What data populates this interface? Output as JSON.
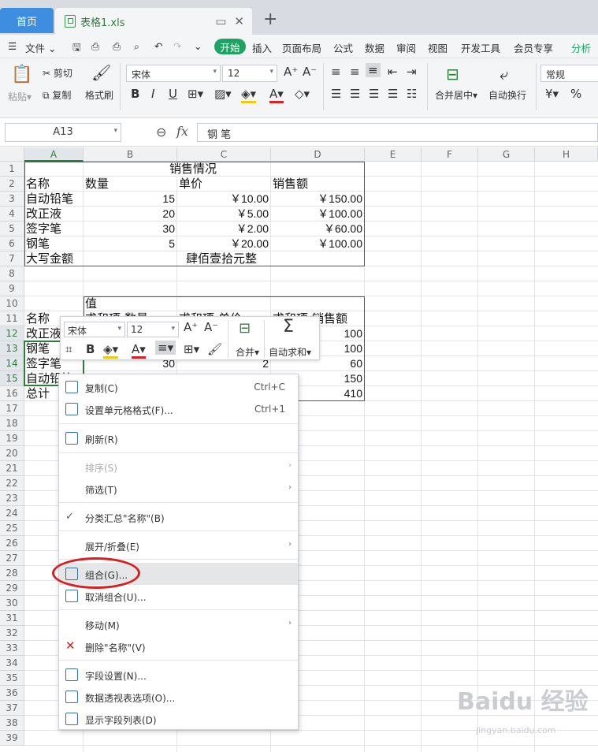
{
  "tabs": {
    "home": "首页",
    "file": "表格1.xls",
    "new_tab": "+"
  },
  "menu": {
    "file": "文件",
    "items": [
      "开始",
      "插入",
      "页面布局",
      "公式",
      "数据",
      "审阅",
      "视图",
      "开发工具",
      "会员专享",
      "分析"
    ]
  },
  "ribbon": {
    "paste": "粘贴",
    "cut": "剪切",
    "copy": "复制",
    "format_painter": "格式刷",
    "font": "宋体",
    "size": "12",
    "merge": "合并居中",
    "wrap": "自动换行",
    "number_format": "常规",
    "bold": "B",
    "italic": "I",
    "underline": "U",
    "currency": "¥",
    "percent": "%"
  },
  "formula_bar": {
    "cell_ref": "A13",
    "fx": "fx",
    "content": "钢 笔"
  },
  "columns": [
    "A",
    "B",
    "C",
    "D",
    "E",
    "F",
    "G",
    "H"
  ],
  "rows": [
    "1",
    "2",
    "3",
    "4",
    "5",
    "6",
    "7",
    "8",
    "9",
    "10",
    "11",
    "12",
    "13",
    "14",
    "15",
    "16",
    "17",
    "18",
    "19",
    "20",
    "21",
    "22",
    "23",
    "24",
    "25",
    "26",
    "27",
    "28",
    "29",
    "30",
    "31",
    "32",
    "33",
    "34",
    "35",
    "36",
    "37",
    "38",
    "39"
  ],
  "sheet": {
    "title": "销售情况",
    "header": [
      "名称",
      "数量",
      "单价",
      "销售额"
    ],
    "data": [
      {
        "name": "自动铅笔",
        "qty": "15",
        "price": "￥10.00",
        "amount": "￥150.00"
      },
      {
        "name": "改正液",
        "qty": "20",
        "price": "￥5.00",
        "amount": "￥100.00"
      },
      {
        "name": "签字笔",
        "qty": "30",
        "price": "￥2.00",
        "amount": "￥60.00"
      },
      {
        "name": "钢笔",
        "qty": "5",
        "price": "￥20.00",
        "amount": "￥100.00"
      }
    ],
    "total_label": "大写金额",
    "total_value": "肆佰壹拾元整",
    "pivot": {
      "values_label": "值",
      "header": [
        "名称",
        "求和项:数量",
        "求和项:单价",
        "求和项:销售额"
      ],
      "rows": [
        {
          "name": "改正液",
          "d": "100"
        },
        {
          "name": "钢笔",
          "d": "100"
        },
        {
          "name": "签字笔",
          "qty": "30",
          "price": "2",
          "d": "60"
        },
        {
          "name": "自动铅笔",
          "d": "150"
        },
        {
          "name": "总计",
          "d": "410"
        }
      ]
    }
  },
  "mini_toolbar": {
    "font": "宋体",
    "size": "12",
    "merge": "合并",
    "autosum": "自动求和"
  },
  "context_menu": [
    {
      "label": "复制(C)",
      "shortcut": "Ctrl+C"
    },
    {
      "label": "设置单元格格式(F)...",
      "shortcut": "Ctrl+1"
    },
    {
      "label": "刷新(R)"
    },
    {
      "label": "排序(S)"
    },
    {
      "label": "筛选(T)"
    },
    {
      "label": "分类汇总\"名称\"(B)"
    },
    {
      "label": "展开/折叠(E)"
    },
    {
      "label": "组合(G)..."
    },
    {
      "label": "取消组合(U)..."
    },
    {
      "label": "移动(M)"
    },
    {
      "label": "删除\"名称\"(V)"
    },
    {
      "label": "字段设置(N)..."
    },
    {
      "label": "数据透视表选项(O)..."
    },
    {
      "label": "显示字段列表(D)"
    }
  ],
  "colors": {
    "accent": "#1fa363",
    "highlight": "#d81e1e",
    "selection": "#2f7d3b"
  }
}
